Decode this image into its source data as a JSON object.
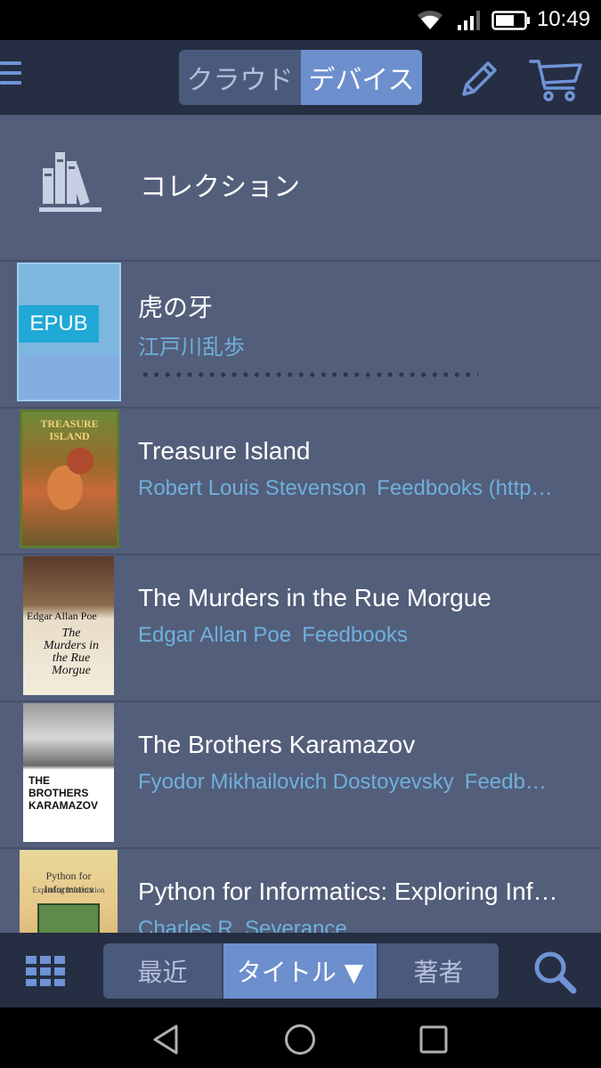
{
  "status_bar": {
    "time": "10:49",
    "icons": [
      "wifi-icon",
      "signal-icon",
      "battery-icon"
    ]
  },
  "header": {
    "menu_icon": "hamburger-menu-icon",
    "tabs": [
      {
        "label": "クラウド",
        "selected": false
      },
      {
        "label": "デバイス",
        "selected": true
      }
    ],
    "edit_icon": "pencil-icon",
    "cart_icon": "shopping-cart-icon"
  },
  "collection": {
    "icon": "bookshelf-icon",
    "label": "コレクション"
  },
  "books": [
    {
      "title": "虎の牙",
      "author": "江戸川乱歩",
      "publisher": "",
      "cover_label": "EPUB",
      "show_progress": true
    },
    {
      "title": "Treasure Island",
      "author": "Robert Louis Stevenson",
      "publisher": "Feedbooks (http…",
      "cover_label": "TREASURE ISLAND"
    },
    {
      "title": "The Murders in the Rue Morgue",
      "author": "Edgar Allan Poe",
      "publisher": "Feedbooks",
      "cover_label": "Edgar Allan Poe",
      "cover_title": "The Murders in the Rue Morgue"
    },
    {
      "title": "The Brothers Karamazov",
      "author": "Fyodor Mikhailovich Dostoyevsky",
      "publisher": "Feedb…",
      "cover_label": "THE BROTHERS KARAMAZOV"
    },
    {
      "title": "Python for Informatics: Exploring Inf…",
      "author": "Charles R. Severance",
      "publisher": "",
      "cover_label": "Python for Informatics",
      "cover_subtitle": "Exploring Information"
    }
  ],
  "bottom_bar": {
    "grid_icon": "grid-view-icon",
    "sort_options": [
      {
        "label": "最近",
        "selected": false
      },
      {
        "label": "タイトル ▼",
        "selected": true
      },
      {
        "label": "著者",
        "selected": false
      }
    ],
    "search_icon": "search-icon"
  },
  "nav_bar": {
    "icons": [
      "back-icon",
      "home-icon",
      "recents-icon"
    ]
  },
  "colors": {
    "appbar_bg": "#252e42",
    "list_bg": "#535e7a",
    "accent": "#6d8fce",
    "link_text": "#6fb0dc"
  }
}
